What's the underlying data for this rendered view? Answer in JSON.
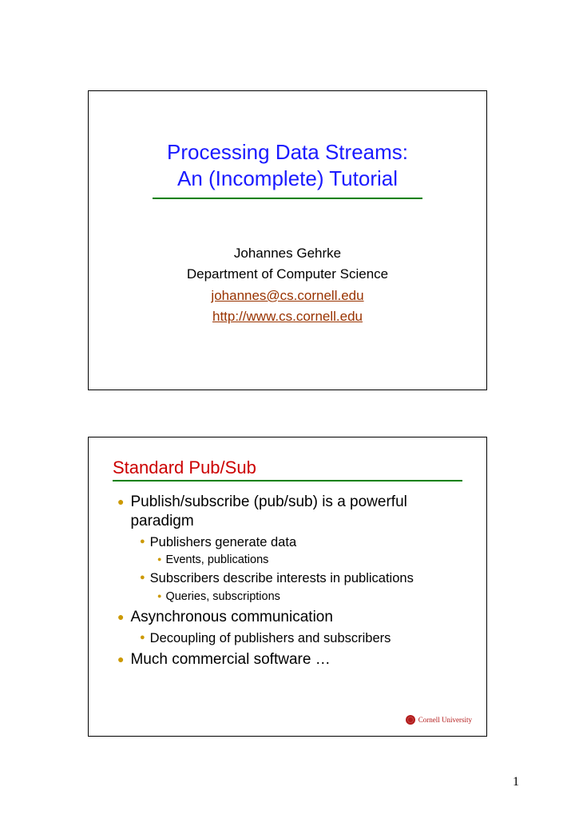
{
  "slide1": {
    "title_line1": "Processing Data Streams:",
    "title_line2": "An (Incomplete) Tutorial",
    "author": "Johannes Gehrke",
    "dept": "Department of Computer Science",
    "email": "johannes@cs.cornell.edu",
    "url": "http://www.cs.cornell.edu"
  },
  "slide2": {
    "heading": "Standard Pub/Sub",
    "bullets": {
      "b1": "Publish/subscribe (pub/sub) is a powerful paradigm",
      "b1a": "Publishers generate data",
      "b1a1": "Events, publications",
      "b1b": "Subscribers describe interests in publications",
      "b1b1": "Queries, subscriptions",
      "b2": "Asynchronous communication",
      "b2a": "Decoupling of publishers and subscribers",
      "b3": "Much commercial software …"
    },
    "footer": "Cornell University"
  },
  "page_number": "1"
}
